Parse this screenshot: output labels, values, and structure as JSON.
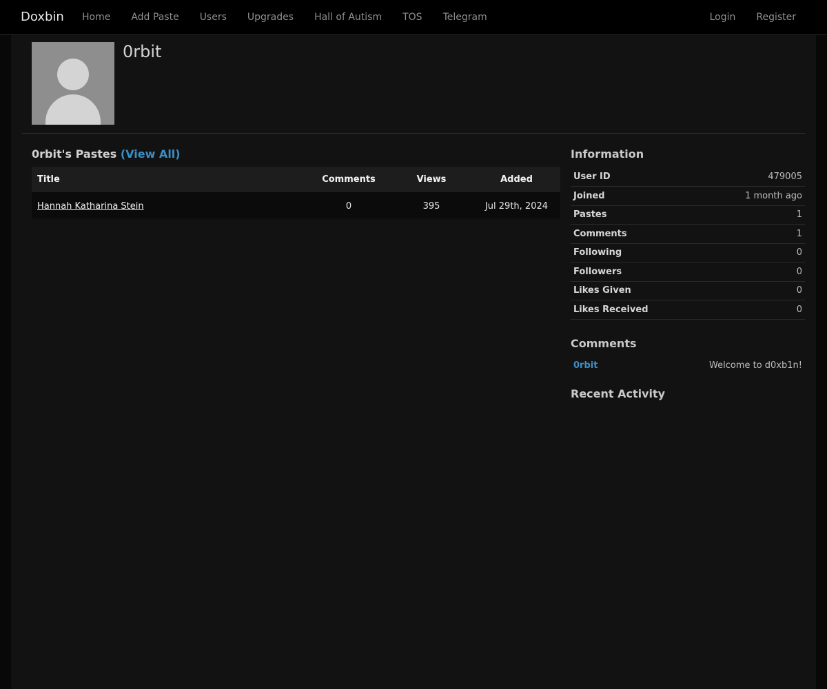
{
  "navbar": {
    "brand": "Doxbin",
    "left_links": [
      "Home",
      "Add Paste",
      "Users",
      "Upgrades",
      "Hall of Autism",
      "TOS",
      "Telegram"
    ],
    "right_links": [
      "Login",
      "Register"
    ]
  },
  "profile": {
    "username": "0rbit"
  },
  "pastes": {
    "heading": "0rbit's Pastes",
    "view_all": "(View All)",
    "columns": {
      "title": "Title",
      "comments": "Comments",
      "views": "Views",
      "added": "Added"
    },
    "rows": [
      {
        "title": "Hannah Katharina Stein",
        "comments": "0",
        "views": "395",
        "added": "Jul 29th, 2024"
      }
    ]
  },
  "information": {
    "heading": "Information",
    "rows": [
      {
        "label": "User ID",
        "value": "479005"
      },
      {
        "label": "Joined",
        "value": "1 month ago"
      },
      {
        "label": "Pastes",
        "value": "1"
      },
      {
        "label": "Comments",
        "value": "1"
      },
      {
        "label": "Following",
        "value": "0"
      },
      {
        "label": "Followers",
        "value": "0"
      },
      {
        "label": "Likes Given",
        "value": "0"
      },
      {
        "label": "Likes Received",
        "value": "0"
      }
    ]
  },
  "comments": {
    "heading": "Comments",
    "items": [
      {
        "author": "0rbit",
        "text": "Welcome to d0xb1n!"
      }
    ]
  },
  "recent_activity": {
    "heading": "Recent Activity"
  },
  "colors": {
    "link_blue": "#3a8fc7",
    "background": "#121212",
    "navbar": "#000000"
  }
}
